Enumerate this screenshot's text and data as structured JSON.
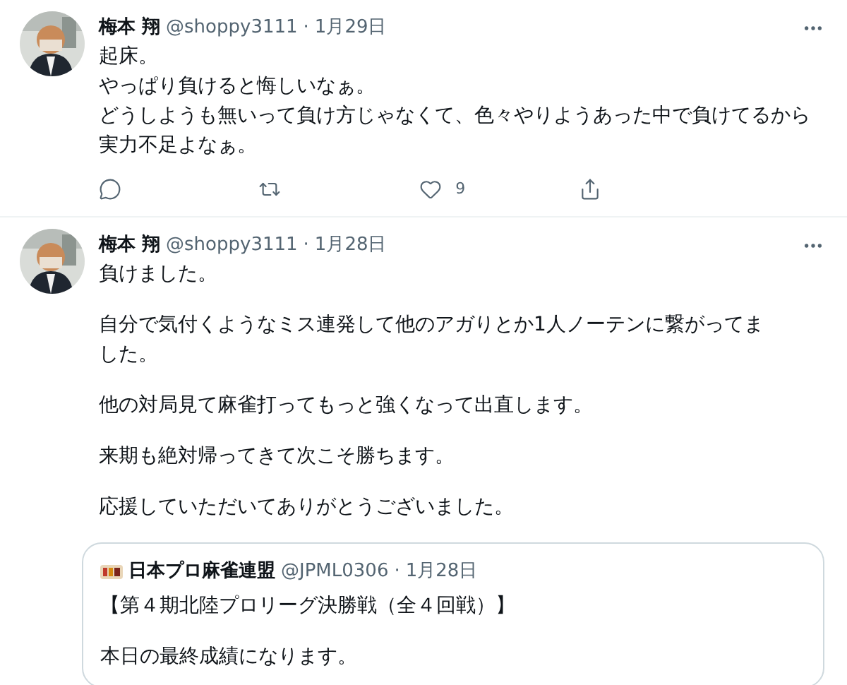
{
  "tweets": [
    {
      "name": "梅本 翔",
      "handle": "@shoppy3111",
      "separator": "·",
      "date": "1月29日",
      "lines": [
        "起床。",
        "やっぱり負けると悔しいなぁ。",
        "どうしようも無いって負け方じゃなくて、色々やりようあった中で負けてるから",
        "実力不足よなぁ。"
      ],
      "actions": [
        {
          "kind": "reply"
        },
        {
          "kind": "retweet"
        },
        {
          "kind": "like",
          "count": "9"
        },
        {
          "kind": "share"
        }
      ]
    },
    {
      "name": "梅本 翔",
      "handle": "@shoppy3111",
      "separator": "·",
      "date": "1月28日",
      "paragraphs": [
        "負けました。",
        "自分で気付くようなミス連発して他のアガりとか1人ノーテンに繋がってました。",
        "他の対局見て麻雀打ってもっと強くなって出直します。",
        "来期も絶対帰ってきて次こそ勝ちます。",
        "応援していただいてありがとうございました。"
      ],
      "quote": {
        "name": "日本プロ麻雀連盟",
        "handle": "@JPML0306",
        "separator": "·",
        "date": "1月28日",
        "paragraphs": [
          "【第４期北陸プロリーグ決勝戦（全４回戦）】",
          "本日の最終成績になります。"
        ]
      }
    }
  ]
}
